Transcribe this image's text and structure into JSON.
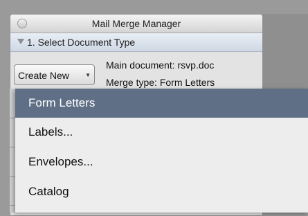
{
  "window": {
    "title": "Mail Merge Manager"
  },
  "section": {
    "label": "1. Select Document Type",
    "expanded": true
  },
  "create_button": {
    "label": "Create New",
    "arrow": "▼"
  },
  "document": {
    "main_document": "Main document: rsvp.doc",
    "merge_type": "Merge type: Form Letters"
  },
  "menu": {
    "items": [
      {
        "label": "Form Letters",
        "selected": true
      },
      {
        "label": "Labels...",
        "selected": false
      },
      {
        "label": "Envelopes...",
        "selected": false
      },
      {
        "label": "Catalog",
        "selected": false
      }
    ]
  },
  "colors": {
    "selection": "#5f7086",
    "menu_bg": "#ededed"
  }
}
